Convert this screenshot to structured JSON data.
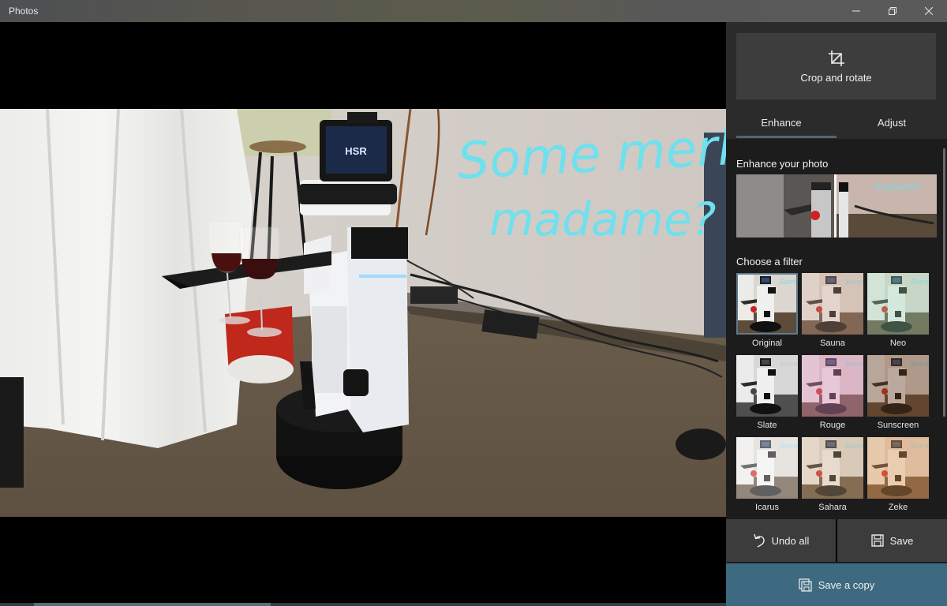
{
  "window": {
    "title": "Photos",
    "controls": {
      "minimize": "minimize-icon",
      "restore": "restore-icon",
      "close": "close-icon"
    }
  },
  "photo": {
    "description": "Toyota HSR robot holding tray with two glasses of red wine, handwritten annotation on wall",
    "ink_annotation": [
      "Some merlot,",
      "madame?"
    ],
    "ink_color": "#6fe0ee",
    "robot_screen_text": "HSR"
  },
  "panel": {
    "crop_button": {
      "icon": "crop-icon",
      "label": "Crop and rotate"
    },
    "tabs": [
      {
        "label": "Enhance",
        "active": true
      },
      {
        "label": "Adjust",
        "active": false
      }
    ],
    "enhance": {
      "title": "Enhance your photo"
    },
    "filters": {
      "title": "Choose a filter",
      "items": [
        {
          "name": "Original",
          "selected": true,
          "tint": "#00000000"
        },
        {
          "name": "Sauna",
          "selected": false,
          "tint": "#c9a08a55"
        },
        {
          "name": "Neo",
          "selected": false,
          "tint": "#9fd9b455"
        },
        {
          "name": "Slate",
          "selected": false,
          "tint": "#8a8a8a00"
        },
        {
          "name": "Rouge",
          "selected": false,
          "tint": "#d98ab466"
        },
        {
          "name": "Sunscreen",
          "selected": false,
          "tint": "#6b3f2066"
        },
        {
          "name": "Icarus",
          "selected": false,
          "tint": "#ffffff55"
        },
        {
          "name": "Sahara",
          "selected": false,
          "tint": "#d6b08a55"
        },
        {
          "name": "Zeke",
          "selected": false,
          "tint": "#e0955066"
        }
      ]
    },
    "actions": {
      "undo_all": {
        "icon": "undo-icon",
        "label": "Undo all"
      },
      "save": {
        "icon": "save-icon",
        "label": "Save"
      },
      "save_copy": {
        "icon": "save-copy-icon",
        "label": "Save a copy"
      }
    }
  },
  "colors": {
    "accent": "#3d6a80",
    "tab_underline": "#4f6674",
    "panel_bg": "#1c1c1c",
    "button_bg": "#3c3c3c"
  }
}
